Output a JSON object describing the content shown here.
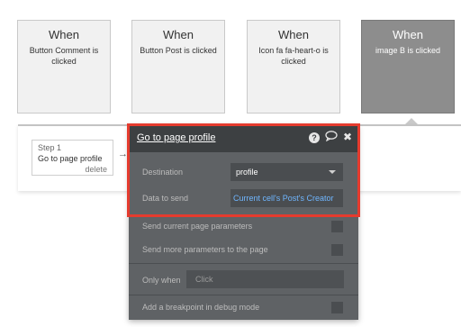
{
  "events": [
    {
      "when": "When",
      "description": "Button Comment is clicked",
      "active": false
    },
    {
      "when": "When",
      "description": "Button Post is clicked",
      "active": false
    },
    {
      "when": "When",
      "description": "Icon fa fa-heart-o is clicked",
      "active": false
    },
    {
      "when": "When",
      "description": "image B is clicked",
      "active": true
    }
  ],
  "step": {
    "label": "Step 1",
    "action": "Go to page profile",
    "delete_label": "delete",
    "arrow": "→"
  },
  "panel": {
    "title": "Go to page profile",
    "icons": {
      "help": "?",
      "comment": "💬",
      "close": "✖"
    },
    "destination_label": "Destination",
    "destination_value": "profile",
    "data_to_send_label": "Data to send",
    "data_to_send_value": "Current cell's Post's Creator",
    "send_current_params_label": "Send current page parameters",
    "send_more_params_label": "Send more parameters to the page",
    "only_when_label": "Only when",
    "only_when_placeholder": "Click",
    "debug_breakpoint_label": "Add a breakpoint in debug mode"
  },
  "colors": {
    "highlight": "#e53b2e",
    "panel_bg": "#5f6265",
    "panel_header_bg": "#3d4042",
    "link_blue": "#6fb6ff",
    "active_event_bg": "#8d8d8d"
  }
}
